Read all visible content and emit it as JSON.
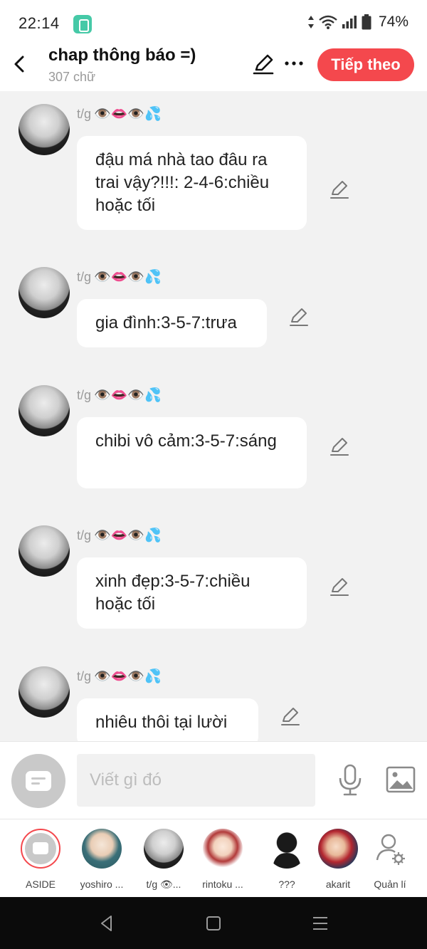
{
  "status": {
    "time": "22:14",
    "battery": "74%"
  },
  "header": {
    "title": "chap thông báo =)",
    "subtitle": "307 chữ",
    "next_label": "Tiếp theo"
  },
  "messages": [
    {
      "author": "t/g",
      "emojis": "👁️👄👁️💦",
      "text": "đậu má nhà tao đâu ra trai vậy?!!!: 2-4-6:chiều hoặc tối"
    },
    {
      "author": "t/g",
      "emojis": "👁️👄👁️💦",
      "text": "gia đình:3-5-7:trưa"
    },
    {
      "author": "t/g",
      "emojis": "👁️👄👁️💦",
      "text": "chibi vô cảm:3-5-7:sáng"
    },
    {
      "author": "t/g",
      "emojis": "👁️👄👁️💦",
      "text": "xinh đẹp:3-5-7:chiều hoặc tối"
    },
    {
      "author": "t/g",
      "emojis": "👁️👄👁️💦",
      "text": "nhiêu thôi tại lười"
    }
  ],
  "input": {
    "placeholder": "Viết gì đó"
  },
  "characters": [
    {
      "label": "ASIDE"
    },
    {
      "label": "yoshiro ..."
    },
    {
      "label": "t/g 👁..."
    },
    {
      "label": "rintoku ..."
    },
    {
      "label": "???"
    },
    {
      "label": "akarit"
    },
    {
      "label": "Quản lí"
    }
  ],
  "colors": {
    "accent": "#f4484d",
    "background": "#f2f2f2",
    "bubble": "#ffffff",
    "muted_text": "#9a9a9a"
  }
}
